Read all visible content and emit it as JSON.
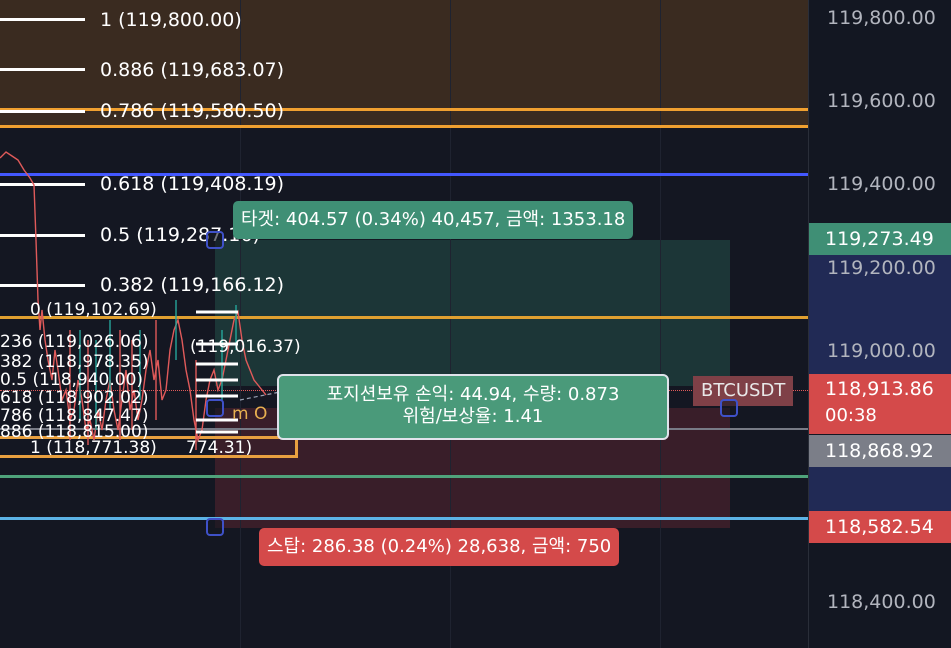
{
  "symbol": "BTCUSDT",
  "colors": {
    "background": "#141722",
    "target_zone": "#1f3b3c",
    "stop_zone": "#3a1f29",
    "fib_top_band": "#3a2a1f",
    "orange_line": "#f0a030",
    "blue_line": "#4358ff",
    "teal_line": "#4fa37b",
    "cyan_line": "#5cb3e6",
    "red_candle": "#e05a5a",
    "green_candle": "#26a69a"
  },
  "fib_levels": [
    {
      "label": "1 (119,800.00)"
    },
    {
      "label": "0.886 (119,683.07)"
    },
    {
      "label": "0.786 (119,580.50)"
    },
    {
      "label": "0.618 (119,408.19)"
    },
    {
      "label": "0.5 (119,287.16)"
    },
    {
      "label": "0.382 (119,166.12)"
    }
  ],
  "small_fib": {
    "zero_label": "0 (119,102.69)",
    "rows": [
      {
        "label": "236 (119,026.06)"
      },
      {
        "label": "382 (118,978.35)"
      },
      {
        "label": "0.5 (118,940.00)"
      },
      {
        "label": "618 (118,902.02)"
      },
      {
        "label": "786 (118,847.47)"
      },
      {
        "label": "886 (118,815.00)"
      },
      {
        "label": "1 (118,771.38)"
      }
    ],
    "side_label_1": "(119,016.37)",
    "side_label_2": "774.31)",
    "fragment": "m O"
  },
  "target_callout": "타겟: 404.57 (0.34%) 40,457, 금액: 1353.18",
  "stop_callout": "스탑: 286.38 (0.24%) 28,638, 금액: 750",
  "position_callout": {
    "line1": "포지션보유 손익: 44.94, 수량: 0.873",
    "line2": "위험/보상율: 1.41"
  },
  "price_axis": {
    "labels": [
      "119,800.00",
      "119,600.00",
      "119,400.00",
      "119,200.00",
      "119,000.00",
      "118,400.00"
    ],
    "target_tag": "119,273.49",
    "current_price": "118,913.86",
    "countdown": "00:38",
    "entry_tag": "118,868.92",
    "stop_tag": "118,582.54"
  }
}
